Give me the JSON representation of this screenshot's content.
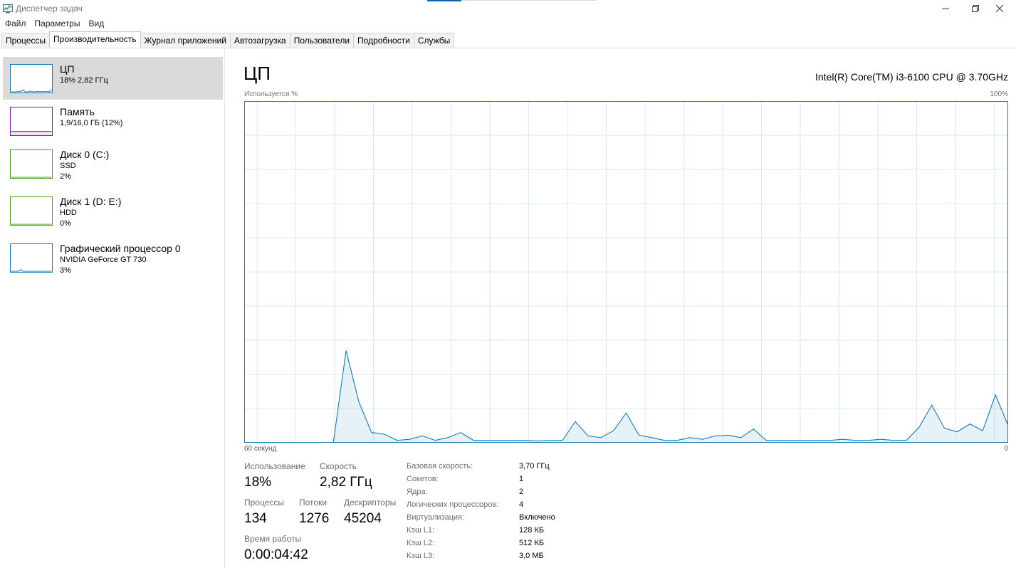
{
  "window": {
    "title": "Диспетчер задач"
  },
  "menu": [
    "Файл",
    "Параметры",
    "Вид"
  ],
  "tabs": [
    {
      "label": "Процессы"
    },
    {
      "label": "Производительность"
    },
    {
      "label": "Журнал приложений"
    },
    {
      "label": "Автозагрузка"
    },
    {
      "label": "Пользователи"
    },
    {
      "label": "Подробности"
    },
    {
      "label": "Службы"
    }
  ],
  "resources": [
    {
      "name": "ЦП",
      "sub1": "18%  2,82 ГГц",
      "sub2": "",
      "color": "#117dbb",
      "mini": [
        0,
        0,
        0,
        2,
        1,
        8,
        0,
        0,
        3,
        1,
        0,
        2,
        1,
        1,
        1,
        2,
        0,
        9
      ]
    },
    {
      "name": "Память",
      "sub1": "1,9/16,0 ГБ (12%)",
      "sub2": "",
      "color": "#8b12ae",
      "mini": [
        12,
        12,
        12,
        12,
        12,
        12,
        12,
        12,
        12,
        12,
        12,
        12,
        12,
        12,
        12,
        12,
        12,
        12
      ]
    },
    {
      "name": "Диск 0 (C:)",
      "sub1": "SSD",
      "sub2": "2%",
      "color": "#4da60c",
      "mini": [
        0,
        0,
        0,
        0,
        0,
        0,
        0,
        0,
        0,
        0,
        0,
        0,
        0,
        0,
        0,
        1,
        0,
        0
      ]
    },
    {
      "name": "Диск 1 (D: E:)",
      "sub1": "HDD",
      "sub2": "0%",
      "color": "#4da60c",
      "mini": [
        0,
        0,
        0,
        0,
        0,
        0,
        0,
        0,
        0,
        0,
        0,
        0,
        0,
        0,
        0,
        0,
        0,
        0
      ]
    },
    {
      "name": "Графический процессор 0",
      "sub1": "NVIDIA GeForce GT 730",
      "sub2": "3%",
      "color": "#117dbb",
      "mini": [
        0,
        0,
        0,
        0,
        6,
        0,
        0,
        0,
        0,
        0,
        0,
        0,
        0,
        0,
        0,
        0,
        0,
        0
      ]
    }
  ],
  "main": {
    "title": "ЦП",
    "cpu_model": "Intel(R) Core(TM) i3-6100 CPU @ 3.70GHz",
    "axis_top_left": "Используется %",
    "axis_top_right": "100%",
    "axis_bottom_left": "60 секунд",
    "axis_bottom_right": "0"
  },
  "stats": {
    "usage_label": "Использование",
    "usage_value": "18%",
    "speed_label": "Скорость",
    "speed_value": "2,82 ГГц",
    "processes_label": "Процессы",
    "processes_value": "134",
    "threads_label": "Потоки",
    "threads_value": "1276",
    "handles_label": "Дескрипторы",
    "handles_value": "45204",
    "uptime_label": "Время работы",
    "uptime_value": "0:00:04:42"
  },
  "specs": [
    {
      "label": "Базовая скорость:",
      "value": "3,70 ГГц"
    },
    {
      "label": "Сокетов:",
      "value": "1"
    },
    {
      "label": "Ядра:",
      "value": "2"
    },
    {
      "label": "Логических процессоров:",
      "value": "4"
    },
    {
      "label": "Виртуализация:",
      "value": "Включено"
    },
    {
      "label": "Кэш L1:",
      "value": "128 КБ"
    },
    {
      "label": "Кэш L2:",
      "value": "512 КБ"
    },
    {
      "label": "Кэш L3:",
      "value": "3,0 МБ"
    }
  ],
  "chart_data": {
    "type": "area",
    "title": "",
    "xlabel": "60 секунд",
    "ylabel": "Используется %",
    "xlim": [
      60,
      0
    ],
    "ylim": [
      0,
      100
    ],
    "grid": true,
    "color": "#117dbb",
    "x": [
      60,
      59,
      58,
      57,
      56,
      55,
      54,
      53,
      52,
      51,
      50,
      49,
      48,
      47,
      46,
      45,
      44,
      43,
      42,
      41,
      40,
      39,
      38,
      37,
      36,
      35,
      34,
      33,
      32,
      31,
      30,
      29,
      28,
      27,
      26,
      25,
      24,
      23,
      22,
      21,
      20,
      19,
      18,
      17,
      16,
      15,
      14,
      13,
      12,
      11,
      10,
      9,
      8,
      7,
      6,
      5,
      4,
      3,
      2,
      1,
      0
    ],
    "series": [
      {
        "values": [
          0,
          0,
          0,
          0,
          0,
          0,
          0,
          0,
          27,
          12,
          3,
          2.5,
          0.7,
          1,
          2,
          0.7,
          1.5,
          3,
          0.7,
          0.7,
          0.7,
          0.7,
          0.7,
          0.5,
          0.7,
          0.7,
          6.2,
          2,
          1.5,
          3.5,
          8.7,
          2.2,
          1.5,
          0.7,
          0.7,
          1.5,
          1,
          2,
          2.2,
          1.5,
          4,
          0.7,
          0.7,
          0.7,
          0.7,
          0.7,
          0.7,
          1,
          0.7,
          0.7,
          1,
          0.7,
          0.7,
          4.5,
          11,
          4.2,
          3.2,
          5.5,
          3.5,
          14,
          5
        ]
      }
    ]
  }
}
